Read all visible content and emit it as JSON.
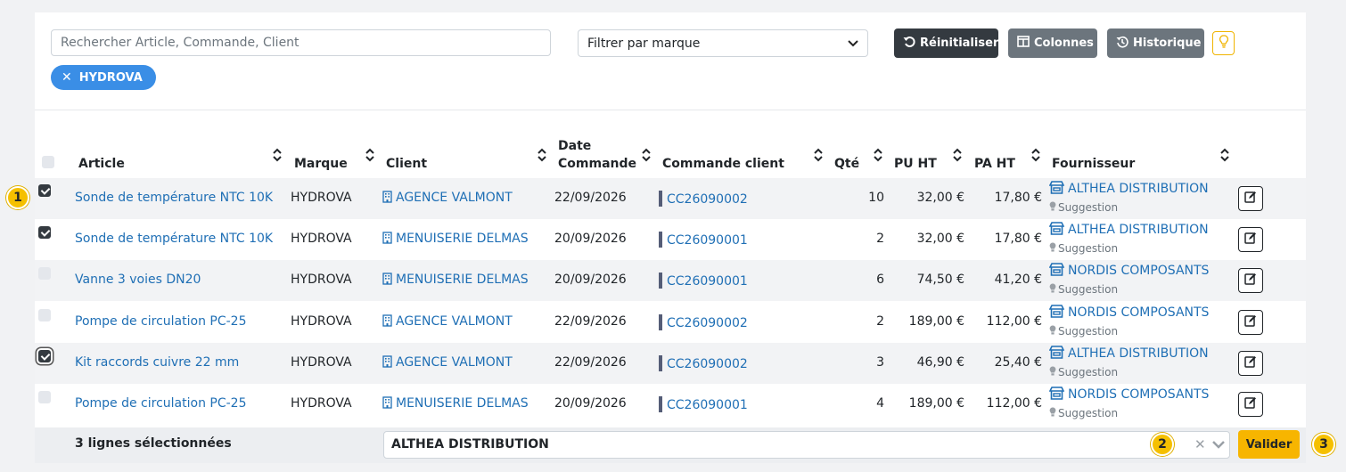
{
  "toolbar": {
    "search_placeholder": "Rechercher Article, Commande, Client",
    "brand_filter": "Filtrer par marque",
    "reset_label": "Réinitialiser",
    "columns_label": "Colonnes",
    "history_label": "Historique",
    "active_filter_chip": "HYDROVA"
  },
  "table": {
    "headers": {
      "article": "Article",
      "brand": "Marque",
      "client": "Client",
      "date_line1": "Date",
      "date_line2": "Commande",
      "client_order": "Commande client",
      "qty": "Qté",
      "pu": "PU HT",
      "pa": "PA HT",
      "supplier": "Fournisseur"
    },
    "rows": [
      {
        "checked": true,
        "article": "Sonde de température NTC 10K",
        "brand": "HYDROVA",
        "client": "AGENCE VALMONT",
        "date": "22/09/2026",
        "order": "CC26090002",
        "qty": "10",
        "pu": "32,00 €",
        "pa": "17,80 €",
        "supplier": "ALTHEA DISTRIBUTION",
        "supplier_note": "Suggestion"
      },
      {
        "checked": true,
        "article": "Sonde de température NTC 10K",
        "brand": "HYDROVA",
        "client": "MENUISERIE DELMAS",
        "date": "20/09/2026",
        "order": "CC26090001",
        "qty": "2",
        "pu": "32,00 €",
        "pa": "17,80 €",
        "supplier": "ALTHEA DISTRIBUTION",
        "supplier_note": "Suggestion"
      },
      {
        "checked": false,
        "article": "Vanne 3 voies DN20",
        "brand": "HYDROVA",
        "client": "MENUISERIE DELMAS",
        "date": "20/09/2026",
        "order": "CC26090001",
        "qty": "6",
        "pu": "74,50 €",
        "pa": "41,20 €",
        "supplier": "NORDIS COMPOSANTS",
        "supplier_note": "Suggestion"
      },
      {
        "checked": false,
        "article": "Pompe de circulation PC-25",
        "brand": "HYDROVA",
        "client": "AGENCE VALMONT",
        "date": "22/09/2026",
        "order": "CC26090002",
        "qty": "2",
        "pu": "189,00 €",
        "pa": "112,00 €",
        "supplier": "NORDIS COMPOSANTS",
        "supplier_note": "Suggestion"
      },
      {
        "checked": true,
        "article": "Kit raccords cuivre 22 mm",
        "brand": "HYDROVA",
        "client": "AGENCE VALMONT",
        "date": "22/09/2026",
        "order": "CC26090002",
        "qty": "3",
        "pu": "46,90 €",
        "pa": "25,40 €",
        "supplier": "ALTHEA DISTRIBUTION",
        "supplier_note": "Suggestion"
      },
      {
        "checked": false,
        "article": "Pompe de circulation PC-25",
        "brand": "HYDROVA",
        "client": "MENUISERIE DELMAS",
        "date": "20/09/2026",
        "order": "CC26090001",
        "qty": "4",
        "pu": "189,00 €",
        "pa": "112,00 €",
        "supplier": "NORDIS COMPOSANTS",
        "supplier_note": "Suggestion"
      }
    ]
  },
  "footer": {
    "selected_count": "3 lignes sélectionnées",
    "supplier_value": "ALTHEA DISTRIBUTION",
    "validate_label": "Valider"
  },
  "badges": [
    "1",
    "2",
    "3"
  ],
  "icons": {
    "reset": "undo-icon",
    "columns": "columns-icon",
    "history": "history-icon",
    "bulb": "lightbulb-icon",
    "client": "building-icon",
    "supplier": "store-icon",
    "suggestion": "lightbulb-icon",
    "edit": "edit-icon"
  },
  "colors": {
    "link": "#1f6fb5",
    "chip": "#3a8ee6",
    "dark_button": "#343a40",
    "grey_button": "#6c757d",
    "validate": "#f7b500",
    "badge": "#f5c000"
  }
}
